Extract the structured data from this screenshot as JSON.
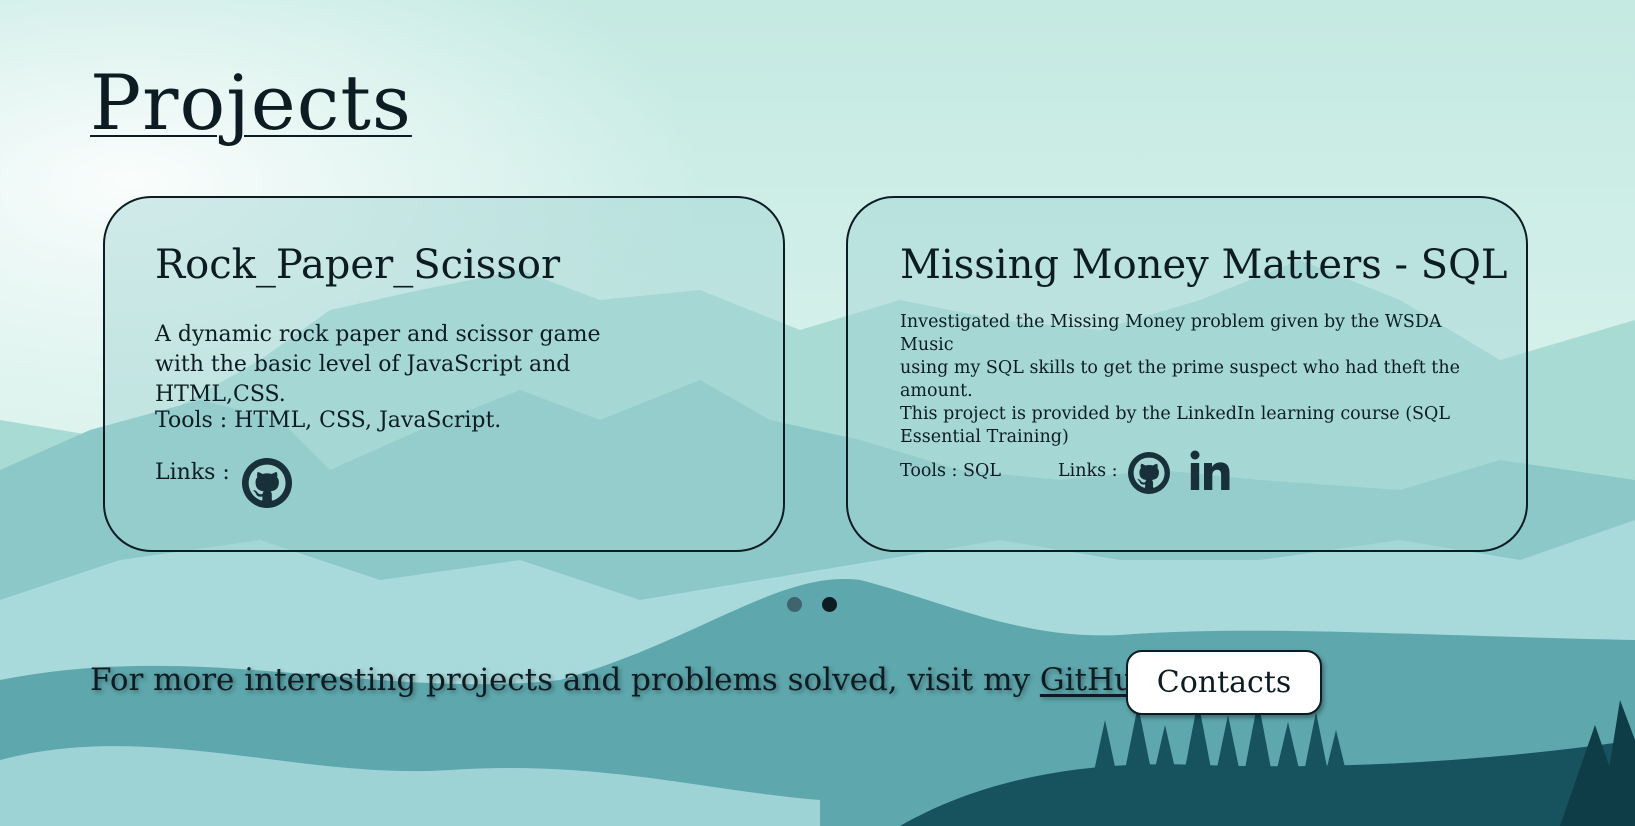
{
  "page": {
    "title": "Projects"
  },
  "projects": [
    {
      "name": "Rock_Paper_Scissor",
      "description": "A dynamic rock paper and scissor game with the basic level of JavaScript and HTML,CSS.",
      "tools": "Tools : HTML, CSS, JavaScript.",
      "links_label": "Links :",
      "icons": [
        "github-icon"
      ]
    },
    {
      "name": "Missing Money Matters - SQL",
      "description_lines": [
        "Investigated the Missing Money problem given by the WSDA Music",
        "using my SQL skills to get the prime suspect who had theft the",
        "amount.",
        "This project is provided by the LinkedIn learning course (SQL",
        "Essential Training)"
      ],
      "tools": "Tools :  SQL",
      "links_label": "Links :",
      "icons": [
        "github-icon",
        "linkedin-icon"
      ]
    }
  ],
  "carousel": {
    "dot_count": 2,
    "active_index": 1
  },
  "footer": {
    "text": "For more interesting projects and problems solved, visit my ",
    "link_label": "GitHub",
    "contacts_label": "Contacts"
  },
  "colors": {
    "text": "#0c1c22",
    "sky_top": "#c4eae2",
    "card_fill": "#a0d2d2",
    "contacts_bg": "#ffffff"
  }
}
